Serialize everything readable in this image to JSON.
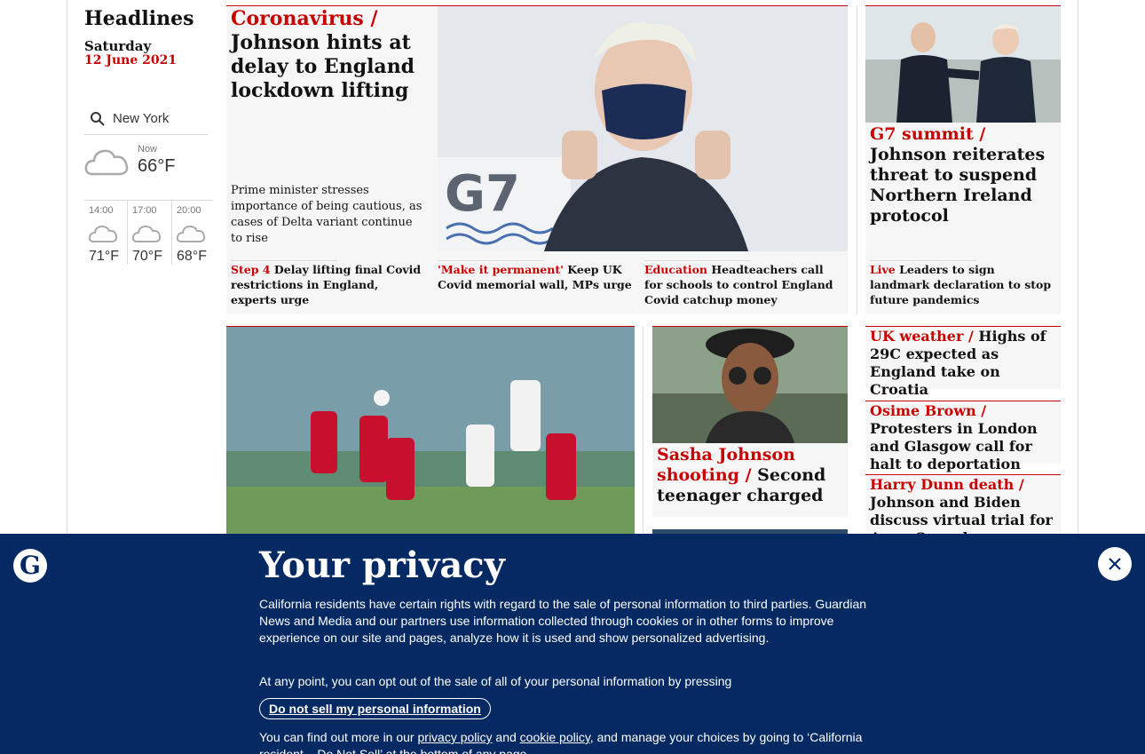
{
  "sidebar": {
    "title": "Headlines",
    "day": "Saturday",
    "date": "12 June 2021",
    "location": "New York",
    "now_label": "Now",
    "now_temp": "66°F",
    "forecast": [
      {
        "time": "14:00",
        "temp": "71°F"
      },
      {
        "time": "17:00",
        "temp": "70°F"
      },
      {
        "time": "20:00",
        "temp": "68°F"
      }
    ]
  },
  "main_story": {
    "kicker": "Coronavirus /",
    "headline": "Johnson hints at delay to England lockdown lifting",
    "standfirst": "Prime minister stresses importance of being cautious, as cases of Delta variant continue to rise",
    "sublinks": [
      {
        "kicker": "Step 4",
        "text": "Delay lifting final Covid restrictions in England, experts urge"
      },
      {
        "kicker": "'Make it permanent'",
        "text": "Keep UK Covid memorial wall, MPs urge"
      },
      {
        "kicker": "Education",
        "text": "Headteachers call for schools to control England Covid catchup money"
      }
    ]
  },
  "g7_story": {
    "kicker": "G7 summit /",
    "headline": "Johnson reiterates threat to suspend Northern Ireland protocol",
    "sublink": {
      "kicker": "Live",
      "text": "Leaders to sign landmark declaration to stop future pandemics"
    }
  },
  "sasha_story": {
    "kicker": "Sasha Johnson shooting /",
    "headline": "Second teenager charged"
  },
  "right_column": [
    {
      "kicker": "UK weather /",
      "headline": "Highs of 29C expected as England take on Croatia"
    },
    {
      "kicker": "Osime Brown /",
      "headline": "Protesters in London and Glasgow call for halt to deportation"
    },
    {
      "kicker": "Harry Dunn death /",
      "headline": "Johnson and Biden discuss virtual trial for Anne Sacoolas"
    }
  ],
  "privacy_banner": {
    "title": "Your privacy",
    "p1": "California residents have certain rights with regard to the sale of personal information to third parties. Guardian News and Media and our partners use information collected through cookies or in other forms to improve experience on our site and pages, analyze how it is used and show personalized advertising.",
    "p2": "At any point, you can opt out of the sale of all of your personal information by pressing",
    "button": "Do not sell my personal information",
    "p3_start": "You can find out more in our",
    "privacy_link": "privacy policy",
    "and": "and",
    "cookie_link": "cookie policy",
    "p3_end": ", and manage your choices by going to ‘California resident – Do Not Sell’ at the bottom of any page.",
    "logo_letter": "G"
  },
  "colors": {
    "accent_red": "#c70000",
    "banner_blue": "#052962",
    "card_bg": "#f6f6f6"
  }
}
